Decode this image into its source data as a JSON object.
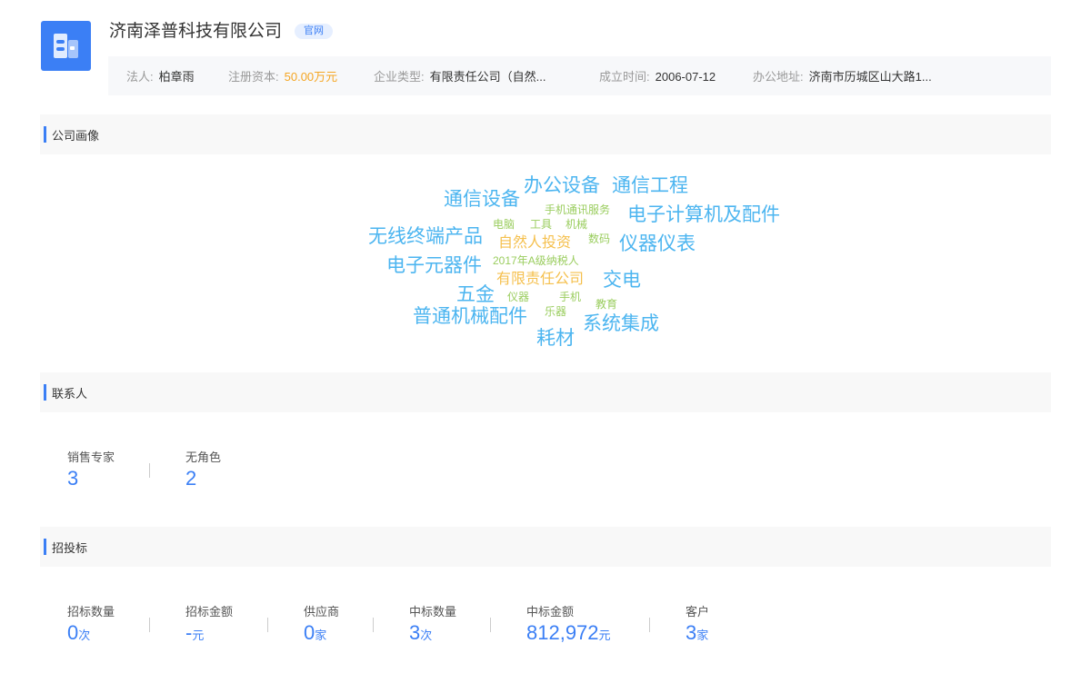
{
  "company": {
    "name": "济南泽普科技有限公司",
    "official_tag": "官网",
    "logo_icon": "building-icon"
  },
  "info": {
    "legal_person_key": "法人:",
    "legal_person_val": "柏章雨",
    "capital_key": "注册资本:",
    "capital_val": "50.00万元",
    "type_key": "企业类型:",
    "type_val": "有限责任公司（自然...",
    "founded_key": "成立时间:",
    "founded_val": "2006-07-12",
    "address_key": "办公地址:",
    "address_val": "济南市历城区山大路1..."
  },
  "sections": {
    "portrait": "公司画像",
    "contacts": "联系人",
    "bidding": "招投标"
  },
  "word_cloud": [
    {
      "text": "办公设备",
      "color": "blue"
    },
    {
      "text": "通信工程",
      "color": "blue"
    },
    {
      "text": "通信设备",
      "color": "blue"
    },
    {
      "text": "手机通讯服务",
      "color": "green"
    },
    {
      "text": "电子计算机及配件",
      "color": "blue"
    },
    {
      "text": "电脑",
      "color": "green"
    },
    {
      "text": "工具",
      "color": "green"
    },
    {
      "text": "机械",
      "color": "green"
    },
    {
      "text": "无线终端产品",
      "color": "blue"
    },
    {
      "text": "自然人投资",
      "color": "orange"
    },
    {
      "text": "数码",
      "color": "green"
    },
    {
      "text": "仪器仪表",
      "color": "blue"
    },
    {
      "text": "电子元器件",
      "color": "blue"
    },
    {
      "text": "2017年A级纳税人",
      "color": "green"
    },
    {
      "text": "有限责任公司",
      "color": "orange"
    },
    {
      "text": "交电",
      "color": "blue"
    },
    {
      "text": "五金",
      "color": "blue"
    },
    {
      "text": "仪器",
      "color": "green"
    },
    {
      "text": "手机",
      "color": "green"
    },
    {
      "text": "教育",
      "color": "green"
    },
    {
      "text": "普通机械配件",
      "color": "blue"
    },
    {
      "text": "乐器",
      "color": "green"
    },
    {
      "text": "系统集成",
      "color": "blue"
    },
    {
      "text": "耗材",
      "color": "blue"
    }
  ],
  "colors": {
    "blue": "#4cb5f0",
    "green": "#9acd5e",
    "orange": "#f5c04e",
    "accent": "#3b7ff5"
  },
  "contacts": [
    {
      "label": "销售专家",
      "value": "3"
    },
    {
      "label": "无角色",
      "value": "2"
    }
  ],
  "bidding": [
    {
      "label": "招标数量",
      "value": "0",
      "unit": "次"
    },
    {
      "label": "招标金额",
      "value": "-",
      "unit": "元"
    },
    {
      "label": "供应商",
      "value": "0",
      "unit": "家"
    },
    {
      "label": "中标数量",
      "value": "3",
      "unit": "次"
    },
    {
      "label": "中标金额",
      "value": "812,972",
      "unit": "元"
    },
    {
      "label": "客户",
      "value": "3",
      "unit": "家"
    }
  ]
}
